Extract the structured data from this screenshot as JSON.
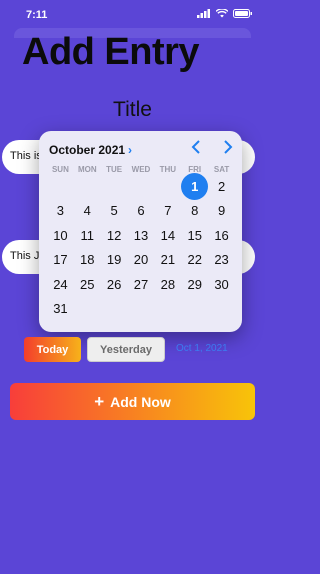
{
  "status": {
    "time": "7:11"
  },
  "page": {
    "title": "Add Entry"
  },
  "form": {
    "title_label": "Title",
    "field1_value": "This is",
    "field2_value": "This J"
  },
  "date_picker": {
    "month_label": "October 2021",
    "weekdays": [
      "SUN",
      "MON",
      "TUE",
      "WED",
      "THU",
      "FRI",
      "SAT"
    ],
    "rows": [
      [
        "",
        "",
        "",
        "",
        "",
        "1",
        "2"
      ],
      [
        "3",
        "4",
        "5",
        "6",
        "7",
        "8",
        "9"
      ],
      [
        "10",
        "11",
        "12",
        "13",
        "14",
        "15",
        "16"
      ],
      [
        "17",
        "18",
        "19",
        "20",
        "21",
        "22",
        "23"
      ],
      [
        "24",
        "25",
        "26",
        "27",
        "28",
        "29",
        "30"
      ],
      [
        "31",
        "",
        "",
        "",
        "",
        "",
        ""
      ]
    ],
    "selected_day": "1"
  },
  "quick_buttons": {
    "today": "Today",
    "yesterday": "Yesterday"
  },
  "selected_date_text": "Oct 1, 2021",
  "actions": {
    "add_now": "Add Now"
  },
  "colors": {
    "background": "#5b45d6",
    "accent": "#1f7ff0"
  }
}
